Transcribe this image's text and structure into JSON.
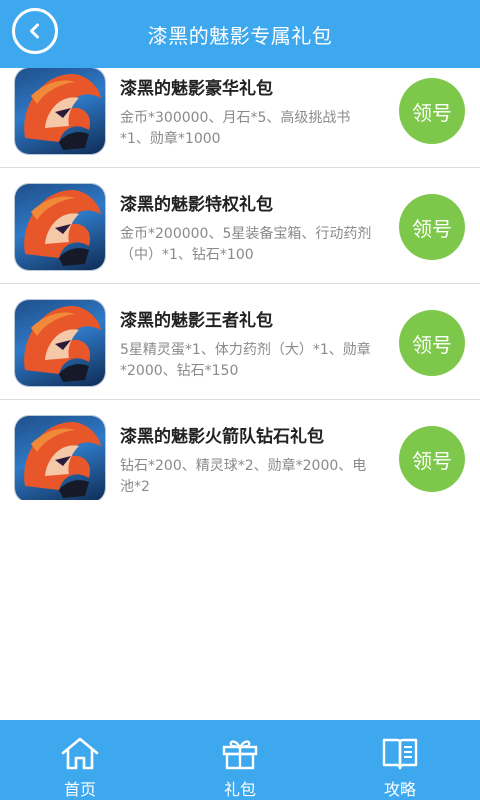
{
  "header": {
    "title": "漆黑的魅影专属礼包",
    "back_icon": "chevron-left-icon"
  },
  "gifts": [
    {
      "title": "漆黑的魅影豪华礼包",
      "desc": "金币*300000、月石*5、高级挑战书*1、勋章*1000",
      "button": "领号"
    },
    {
      "title": "漆黑的魅影特权礼包",
      "desc": "金币*200000、5星装备宝箱、行动药剂（中）*1、钻石*100",
      "button": "领号"
    },
    {
      "title": "漆黑的魅影王者礼包",
      "desc": "5星精灵蛋*1、体力药剂（大）*1、勋章*2000、钻石*150",
      "button": "领号"
    },
    {
      "title": "漆黑的魅影火箭队钻石礼包",
      "desc": "钻石*200、精灵球*2、勋章*2000、电池*2",
      "button": "领号"
    }
  ],
  "tabbar": {
    "home": {
      "label": "首页",
      "icon": "home-icon"
    },
    "gifts": {
      "label": "礼包",
      "icon": "gift-icon"
    },
    "guide": {
      "label": "攻略",
      "icon": "book-icon"
    }
  },
  "colors": {
    "primary": "#3ea8ef",
    "button_green": "#7dc84a",
    "title_text": "#222222",
    "desc_text": "#8a8a8a"
  }
}
